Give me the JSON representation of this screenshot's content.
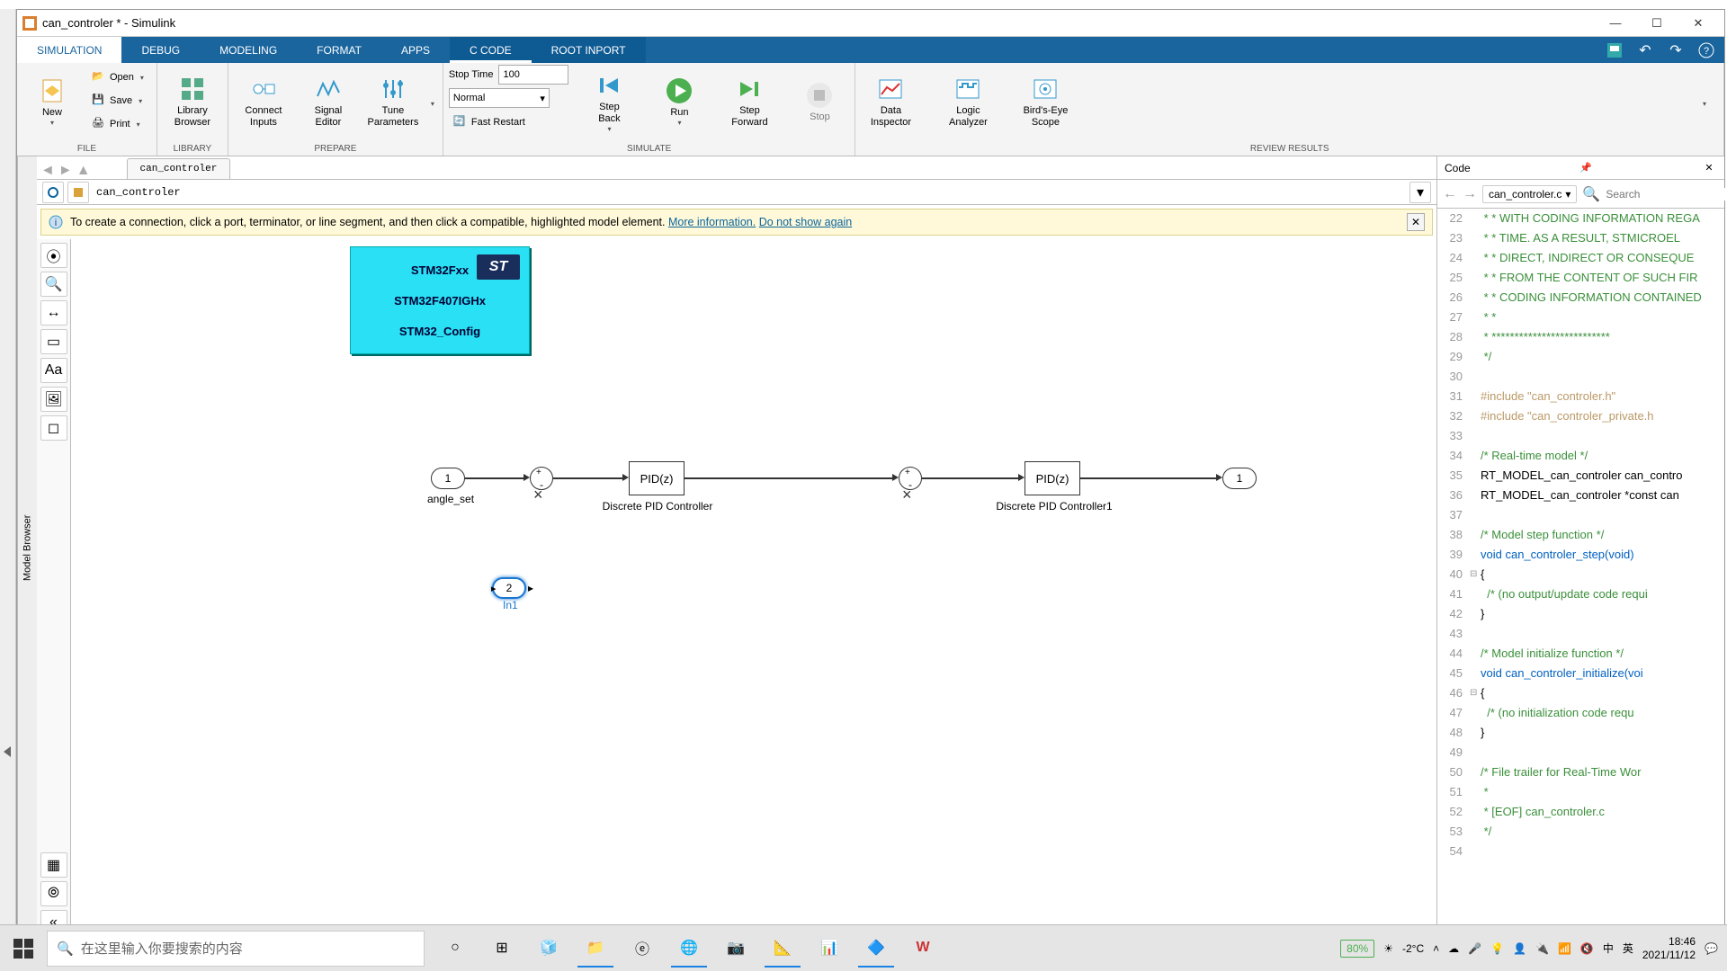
{
  "window": {
    "title": "can_controler * - Simulink"
  },
  "ribbon": {
    "tabs": [
      "SIMULATION",
      "DEBUG",
      "MODELING",
      "FORMAT",
      "APPS",
      "C CODE",
      "ROOT INPORT"
    ],
    "file": {
      "new": "New",
      "open": "Open",
      "save": "Save",
      "print": "Print",
      "label": "FILE"
    },
    "library": {
      "browser": "Library\nBrowser",
      "label": "LIBRARY"
    },
    "prepare": {
      "connect": "Connect\nInputs",
      "signal": "Signal\nEditor",
      "tune": "Tune\nParameters",
      "label": "PREPARE"
    },
    "simulate": {
      "stoptime_lbl": "Stop Time",
      "stoptime_val": "100",
      "mode": "Normal",
      "fastrestart": "Fast Restart",
      "stepback": "Step\nBack",
      "run": "Run",
      "stepfwd": "Step\nForward",
      "stop": "Stop",
      "label": "SIMULATE"
    },
    "review": {
      "data": "Data\nInspector",
      "logic": "Logic\nAnalyzer",
      "birds": "Bird's-Eye\nScope",
      "label": "REVIEW RESULTS"
    }
  },
  "explorer": {
    "tab_label": "Model Browser"
  },
  "tabstrip": {
    "tab": "can_controler"
  },
  "breadcrumb": {
    "text": "can_controler"
  },
  "banner": {
    "text": "To create a connection, click a port, terminator, or line segment, and then click a compatible, highlighted model element. ",
    "more": "More information.",
    "dismiss": "Do not show again"
  },
  "blocks": {
    "stm32_l1": "STM32Fxx",
    "stm32_l2": "STM32F407IGHx",
    "stm32_l3": "STM32_Config",
    "stm32_logo": "ST",
    "in1_num": "1",
    "in1_lbl": "angle_set",
    "in2_num": "2",
    "in2_lbl": "In1",
    "pid1": "PID(z)",
    "pid1_lbl": "Discrete PID Controller",
    "pid2": "PID(z)",
    "pid2_lbl": "Discrete PID Controller1",
    "out1_num": "1"
  },
  "code": {
    "title": "Code",
    "file": "can_controler.c",
    "search_ph": "Search",
    "lines_start": 22,
    "lines": [
      {
        "n": 22,
        "cls": "c-cm",
        "t": " * * WITH CODING INFORMATION REGA"
      },
      {
        "n": 23,
        "cls": "c-cm",
        "t": " * * TIME. AS A RESULT, STMICROEL"
      },
      {
        "n": 24,
        "cls": "c-cm",
        "t": " * * DIRECT, INDIRECT OR CONSEQUE"
      },
      {
        "n": 25,
        "cls": "c-cm",
        "t": " * * FROM THE CONTENT OF SUCH FIR"
      },
      {
        "n": 26,
        "cls": "c-cm",
        "t": " * * CODING INFORMATION CONTAINED"
      },
      {
        "n": 27,
        "cls": "c-cm",
        "t": " * *"
      },
      {
        "n": 28,
        "cls": "c-cm",
        "t": " * **************************"
      },
      {
        "n": 29,
        "cls": "c-cm",
        "t": " */"
      },
      {
        "n": 30,
        "cls": "",
        "t": ""
      },
      {
        "n": 31,
        "cls": "c-pp",
        "t": "#include \"can_controler.h\""
      },
      {
        "n": 32,
        "cls": "c-pp",
        "t": "#include \"can_controler_private.h"
      },
      {
        "n": 33,
        "cls": "",
        "t": ""
      },
      {
        "n": 34,
        "cls": "c-cm",
        "t": "/* Real-time model */"
      },
      {
        "n": 35,
        "cls": "",
        "t": "RT_MODEL_can_controler can_contro"
      },
      {
        "n": 36,
        "cls": "",
        "t": "RT_MODEL_can_controler *const can"
      },
      {
        "n": 37,
        "cls": "",
        "t": ""
      },
      {
        "n": 38,
        "cls": "c-cm",
        "t": "/* Model step function */"
      },
      {
        "n": 39,
        "cls": "c-kw",
        "t": "void can_controler_step(void)"
      },
      {
        "n": 40,
        "cls": "",
        "t": "{",
        "fold": "-"
      },
      {
        "n": 41,
        "cls": "c-cm",
        "t": "  /* (no output/update code requi"
      },
      {
        "n": 42,
        "cls": "",
        "t": "}"
      },
      {
        "n": 43,
        "cls": "",
        "t": ""
      },
      {
        "n": 44,
        "cls": "c-cm",
        "t": "/* Model initialize function */"
      },
      {
        "n": 45,
        "cls": "c-kw",
        "t": "void can_controler_initialize(voi"
      },
      {
        "n": 46,
        "cls": "",
        "t": "{",
        "fold": "-"
      },
      {
        "n": 47,
        "cls": "c-cm",
        "t": "  /* (no initialization code requ"
      },
      {
        "n": 48,
        "cls": "",
        "t": "}"
      },
      {
        "n": 49,
        "cls": "",
        "t": ""
      },
      {
        "n": 50,
        "cls": "c-cm",
        "t": "/* File trailer for Real-Time Wor"
      },
      {
        "n": 51,
        "cls": "c-cm",
        "t": " *"
      },
      {
        "n": 52,
        "cls": "c-cm",
        "t": " * [EOF] can_controler.c"
      },
      {
        "n": 53,
        "cls": "c-cm",
        "t": " */"
      },
      {
        "n": 54,
        "cls": "",
        "t": ""
      }
    ]
  },
  "taskbar": {
    "search_ph": "在这里输入你要搜索的内容",
    "battery": "80%",
    "temp": "-2°C",
    "ime1": "中",
    "ime2": "英",
    "time": "18:46",
    "date": "2021/11/12"
  }
}
